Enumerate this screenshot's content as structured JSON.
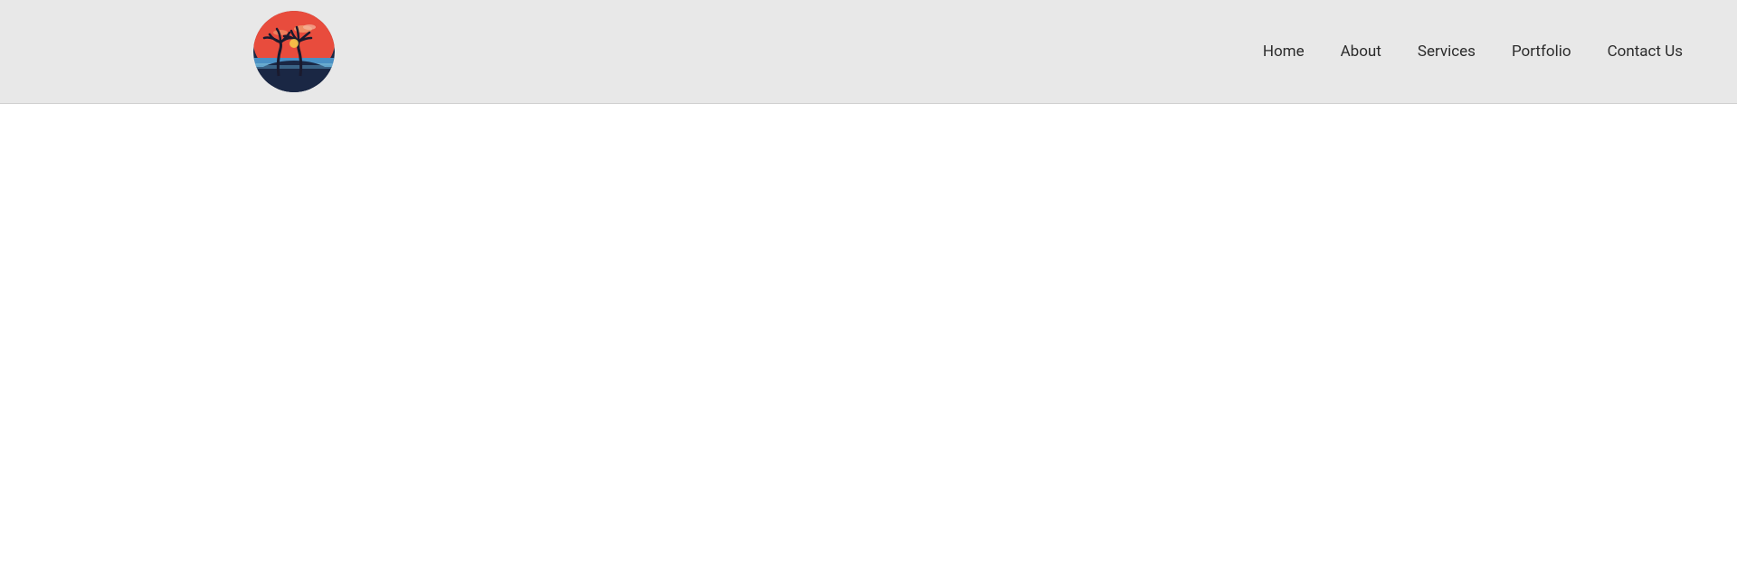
{
  "header": {
    "logo_alt": "Tropical sunset logo",
    "nav": {
      "items": [
        {
          "label": "Home",
          "id": "home"
        },
        {
          "label": "About",
          "id": "about"
        },
        {
          "label": "Services",
          "id": "services"
        },
        {
          "label": "Portfolio",
          "id": "portfolio"
        },
        {
          "label": "Contact Us",
          "id": "contact"
        }
      ]
    }
  },
  "main": {
    "background": "#ffffff"
  }
}
